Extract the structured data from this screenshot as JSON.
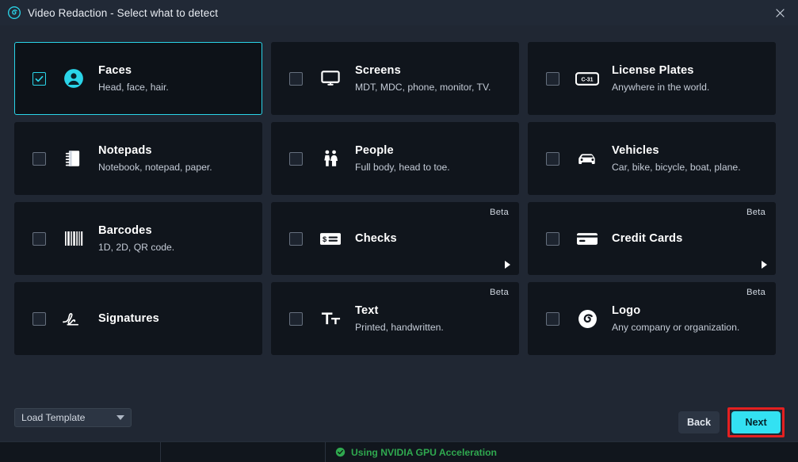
{
  "window": {
    "title": "Video Redaction - Select what to detect",
    "logo_icon": "spiral-logo-icon",
    "close_icon": "close-icon"
  },
  "theme": {
    "accent": "#33e1f2",
    "card_bg": "#10151c",
    "page_bg": "#202733",
    "highlight_box": "#e42020",
    "status_green": "#2fa84f"
  },
  "detection_cards": [
    {
      "id": "faces",
      "title": "Faces",
      "description": "Head, face, hair.",
      "checked": true,
      "selected": true,
      "beta": "",
      "has_expand_arrow": false,
      "icon": "person-circle-icon"
    },
    {
      "id": "screens",
      "title": "Screens",
      "description": "MDT, MDC, phone, monitor, TV.",
      "checked": false,
      "selected": false,
      "beta": "",
      "has_expand_arrow": false,
      "icon": "monitor-icon"
    },
    {
      "id": "license-plates",
      "title": "License Plates",
      "description": "Anywhere in the world.",
      "checked": false,
      "selected": false,
      "beta": "",
      "has_expand_arrow": false,
      "icon": "license-plate-icon"
    },
    {
      "id": "notepads",
      "title": "Notepads",
      "description": "Notebook, notepad, paper.",
      "checked": false,
      "selected": false,
      "beta": "",
      "has_expand_arrow": false,
      "icon": "notebook-icon"
    },
    {
      "id": "people",
      "title": "People",
      "description": "Full body, head to toe.",
      "checked": false,
      "selected": false,
      "beta": "",
      "has_expand_arrow": false,
      "icon": "two-people-icon"
    },
    {
      "id": "vehicles",
      "title": "Vehicles",
      "description": "Car, bike, bicycle, boat, plane.",
      "checked": false,
      "selected": false,
      "beta": "",
      "has_expand_arrow": false,
      "icon": "car-icon"
    },
    {
      "id": "barcodes",
      "title": "Barcodes",
      "description": "1D, 2D, QR code.",
      "checked": false,
      "selected": false,
      "beta": "",
      "has_expand_arrow": false,
      "icon": "barcode-icon"
    },
    {
      "id": "checks",
      "title": "Checks",
      "description": "",
      "checked": false,
      "selected": false,
      "beta": "Beta",
      "has_expand_arrow": true,
      "icon": "check-document-icon"
    },
    {
      "id": "credit-cards",
      "title": "Credit Cards",
      "description": "",
      "checked": false,
      "selected": false,
      "beta": "Beta",
      "has_expand_arrow": true,
      "icon": "credit-card-icon"
    },
    {
      "id": "signatures",
      "title": "Signatures",
      "description": "",
      "checked": false,
      "selected": false,
      "beta": "",
      "has_expand_arrow": false,
      "icon": "signature-icon"
    },
    {
      "id": "text",
      "title": "Text",
      "description": "Printed, handwritten.",
      "checked": false,
      "selected": false,
      "beta": "Beta",
      "has_expand_arrow": false,
      "icon": "text-tt-icon"
    },
    {
      "id": "logo",
      "title": "Logo",
      "description": "Any company or organization.",
      "checked": false,
      "selected": false,
      "beta": "Beta",
      "has_expand_arrow": false,
      "icon": "spiral-logo-icon"
    }
  ],
  "footer": {
    "template_dropdown_label": "Load Template",
    "template_caret_icon": "chevron-down-icon",
    "back_label": "Back",
    "next_label": "Next"
  },
  "status_bar": {
    "gpu_text": "Using NVIDIA GPU Acceleration",
    "gpu_icon": "check-circle-icon"
  }
}
